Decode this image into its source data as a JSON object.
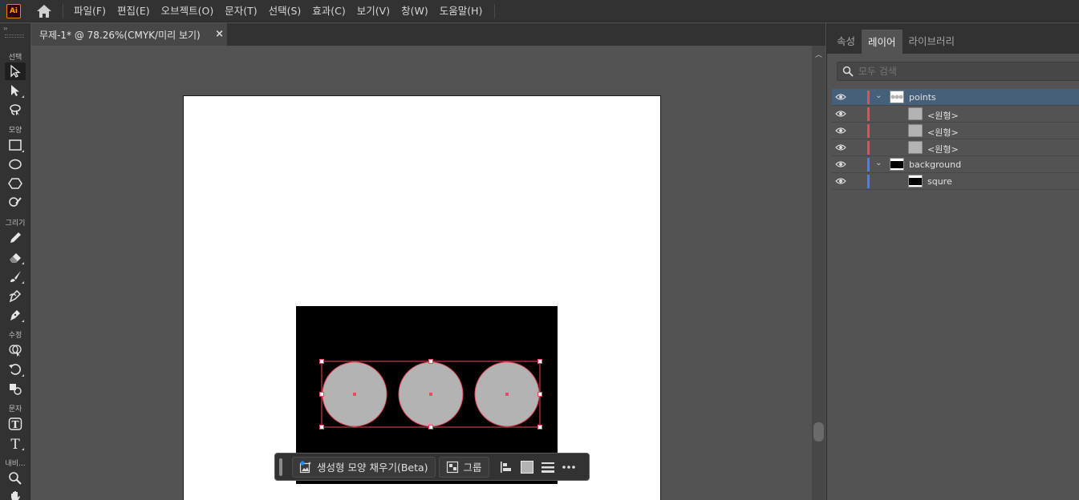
{
  "app": {
    "logo_text": "Ai"
  },
  "menu": {
    "items": [
      "파일(F)",
      "편집(E)",
      "오브젝트(O)",
      "문자(T)",
      "선택(S)",
      "효과(C)",
      "보기(V)",
      "창(W)",
      "도움말(H)"
    ]
  },
  "toolbar": {
    "collapse_glyph": "››",
    "sections": {
      "select": "선택",
      "shape": "모양",
      "draw": "그리기",
      "modify": "수정",
      "type": "문자",
      "navigate": "내비..."
    },
    "tools": [
      "selection-tool",
      "direct-selection-tool",
      "lasso-tool",
      "rectangle-tool",
      "ellipse-tool",
      "polygon-tool",
      "shaper-tool",
      "pencil-tool",
      "eraser-tool",
      "paintbrush-tool",
      "blob-brush-tool",
      "pen-tool",
      "shape-builder-tool",
      "rotate-tool",
      "scale-tool",
      "touch-type-tool",
      "type-tool",
      "zoom-tool",
      "hand-tool"
    ]
  },
  "document": {
    "tab_title": "무제-1* @ 78.26%(CMYK/미리 보기)",
    "close_glyph": "×"
  },
  "canvas": {
    "artboard_color": "#ffffff",
    "background_rect_color": "#000000",
    "circle_fill": "#b3b3b3",
    "selection_color": "#e84a5f",
    "circle_count": 3
  },
  "contextual_taskbar": {
    "generative_fill_label": "생성형 모양 채우기(Beta)",
    "group_label": "그룹"
  },
  "right_panel": {
    "tabs": [
      "속성",
      "레이어",
      "라이브러리"
    ],
    "active_tab": "레이어",
    "search_placeholder": "모두 검색",
    "layers": [
      {
        "name": "points",
        "level": 0,
        "expanded": true,
        "color": "#e84a5f",
        "selected": true
      },
      {
        "name": "<원형>",
        "level": 1,
        "color": "#e84a5f"
      },
      {
        "name": "<원형>",
        "level": 1,
        "color": "#e84a5f"
      },
      {
        "name": "<원형>",
        "level": 1,
        "color": "#e84a5f"
      },
      {
        "name": "background",
        "level": 0,
        "expanded": true,
        "color": "#4a7bff"
      },
      {
        "name": "squre",
        "level": 1,
        "color": "#4a7bff"
      }
    ]
  }
}
